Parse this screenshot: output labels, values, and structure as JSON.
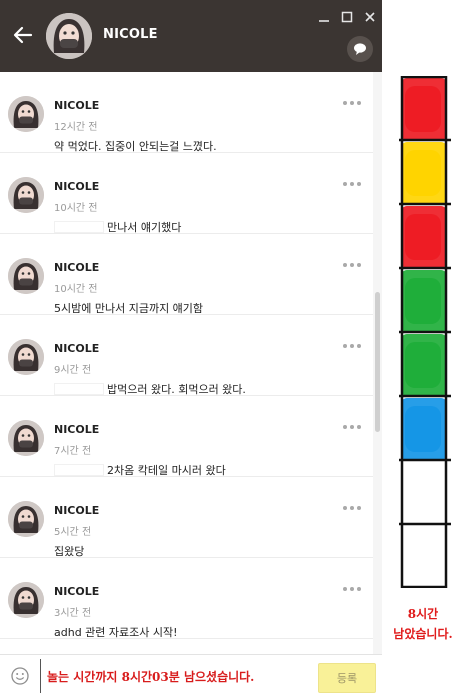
{
  "header": {
    "title": "NICOLE",
    "window_controls": [
      "minimize-icon",
      "maximize-icon",
      "close-icon"
    ]
  },
  "messages": [
    {
      "name": "NICOLE",
      "time": "12시간 전",
      "text": "약 먹었다. 집중이 안되는걸 느꼈다.",
      "masked_prefix": false
    },
    {
      "name": "NICOLE",
      "time": "10시간 전",
      "text": "만나서 얘기했다",
      "masked_prefix": true
    },
    {
      "name": "NICOLE",
      "time": "10시간 전",
      "text": "5시밤에 만나서 지금까지 얘기함",
      "masked_prefix": false
    },
    {
      "name": "NICOLE",
      "time": "9시간 전",
      "text": "밥먹으러 왔다. 회먹으러 왔다.",
      "masked_prefix": true
    },
    {
      "name": "NICOLE",
      "time": "7시간 전",
      "text": "2차옴 칵테일 마시러 왔다",
      "masked_prefix": true
    },
    {
      "name": "NICOLE",
      "time": "5시간 전",
      "text": "집왔당",
      "masked_prefix": false
    },
    {
      "name": "NICOLE",
      "time": "3시간 전",
      "text": "adhd 관련 자료조사 시작!",
      "masked_prefix": false
    }
  ],
  "input": {
    "value": "놀는 시간까지 8시간03분 남으셨습니다.",
    "send_label": "등록"
  },
  "tracker": {
    "caption_line1": "8시간",
    "caption_line2": "남았습니다.",
    "segments_total": 8,
    "segments_filled": 6,
    "colors": [
      "#ee1c24",
      "#ffd400",
      "#ee1c24",
      "#1fae3a",
      "#1fae3a",
      "#1596e6"
    ]
  }
}
